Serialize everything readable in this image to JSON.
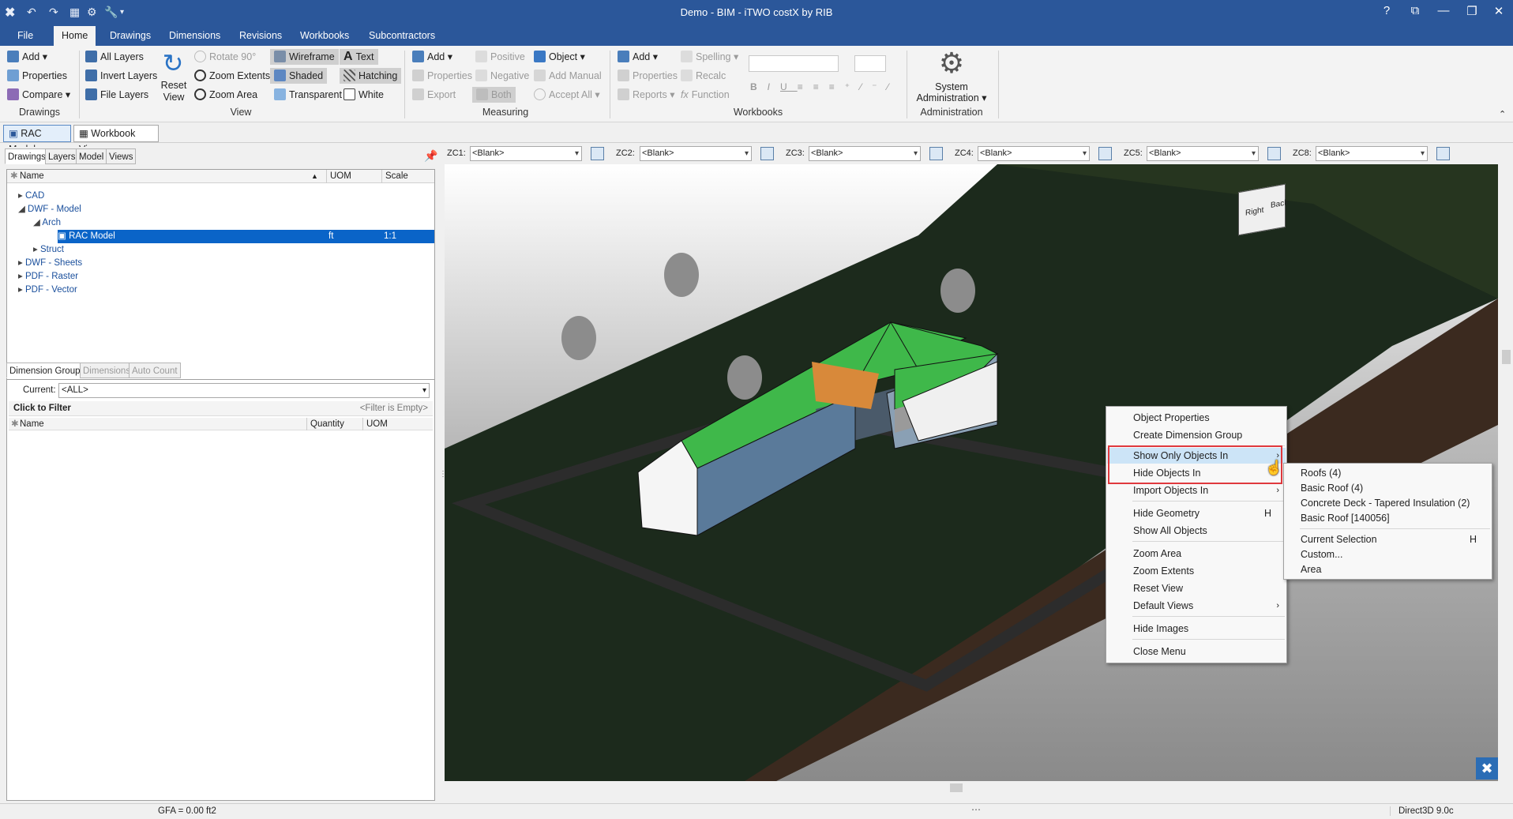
{
  "app": {
    "title": "Demo - BIM - iTWO costX by RIB",
    "window_controls": [
      "?",
      "⧉",
      "—",
      "❐",
      "✕"
    ]
  },
  "ribbon_tabs": [
    "File",
    "Home",
    "Drawings",
    "Dimensions",
    "Revisions",
    "Workbooks",
    "Subcontractors"
  ],
  "ribbon": {
    "drawings": {
      "add": "Add",
      "properties": "Properties",
      "compare": "Compare",
      "group": "Drawings"
    },
    "layers": {
      "all": "All Layers",
      "invert": "Invert Layers",
      "file": "File Layers",
      "reset": "Reset View"
    },
    "view": {
      "rotate": "Rotate 90°",
      "zoom_extents": "Zoom Extents",
      "zoom_area": "Zoom Area",
      "wireframe": "Wireframe",
      "shaded": "Shaded",
      "transparent": "Transparent",
      "text": "Text",
      "hatching": "Hatching",
      "white": "White",
      "group": "View"
    },
    "measuring": {
      "add": "Add",
      "properties": "Properties",
      "export": "Export",
      "positive": "Positive",
      "negative": "Negative",
      "both": "Both",
      "object": "Object",
      "add_manual": "Add Manual",
      "accept_all": "Accept All",
      "group": "Measuring"
    },
    "workbooks": {
      "add": "Add",
      "properties": "Properties",
      "reports": "Reports",
      "spelling": "Spelling",
      "recalc": "Recalc",
      "function": "Function",
      "group": "Workbooks"
    },
    "admin": {
      "system": "System",
      "administration": "Administration ▾",
      "group": "Administration"
    }
  },
  "doc_tabs": [
    "RAC Model",
    "Workbook View"
  ],
  "left_panel": {
    "tabs": [
      "Drawings",
      "Layers",
      "Model",
      "Views"
    ],
    "tree_headers": [
      "Name",
      "UOM",
      "Scale"
    ],
    "tree_rows": [
      {
        "label": "CAD",
        "uom": "",
        "scale": ""
      },
      {
        "label": "DWF - Model",
        "uom": "",
        "scale": ""
      },
      {
        "label": "Arch",
        "uom": "",
        "scale": ""
      },
      {
        "label": "RAC Model",
        "uom": "ft",
        "scale": "1:1"
      },
      {
        "label": "Struct",
        "uom": "",
        "scale": ""
      },
      {
        "label": "DWF - Sheets",
        "uom": "",
        "scale": ""
      },
      {
        "label": "PDF - Raster",
        "uom": "",
        "scale": ""
      },
      {
        "label": "PDF - Vector",
        "uom": "",
        "scale": ""
      }
    ],
    "dim_tabs": [
      "Dimension Groups",
      "Dimensions",
      "Auto Count"
    ],
    "current_label": "Current:",
    "current_value": "<ALL>",
    "filter_label": "Click to Filter",
    "filter_status": "<Filter is Empty>",
    "dim_headers": [
      "Name",
      "Quantity",
      "UOM"
    ]
  },
  "zc_filters": [
    {
      "label": "ZC1:",
      "value": "<Blank>"
    },
    {
      "label": "ZC2:",
      "value": "<Blank>"
    },
    {
      "label": "ZC3:",
      "value": "<Blank>"
    },
    {
      "label": "ZC4:",
      "value": "<Blank>"
    },
    {
      "label": "ZC5:",
      "value": "<Blank>"
    },
    {
      "label": "ZC8:",
      "value": "<Blank>"
    }
  ],
  "context_menu": [
    {
      "label": "Object Properties",
      "shortcut": "",
      "submenu": false
    },
    {
      "label": "Create Dimension Group",
      "shortcut": "",
      "submenu": false
    },
    {
      "label": "Show Only Objects In",
      "shortcut": "",
      "submenu": true,
      "highlighted": true
    },
    {
      "label": "Hide Objects In",
      "shortcut": "",
      "submenu": false
    },
    {
      "label": "Import Objects In",
      "shortcut": "",
      "submenu": true
    },
    {
      "label": "Hide Geometry",
      "shortcut": "H",
      "submenu": false
    },
    {
      "label": "Show All Objects",
      "shortcut": "",
      "submenu": false
    },
    {
      "label": "Zoom Area",
      "shortcut": "",
      "submenu": false
    },
    {
      "label": "Zoom Extents",
      "shortcut": "",
      "submenu": false
    },
    {
      "label": "Reset View",
      "shortcut": "",
      "submenu": false
    },
    {
      "label": "Default Views",
      "shortcut": "",
      "submenu": true
    },
    {
      "label": "Hide Images",
      "shortcut": "",
      "submenu": false
    },
    {
      "label": "Close Menu",
      "shortcut": "",
      "submenu": false
    }
  ],
  "submenu": [
    {
      "label": "Roofs (4)",
      "shortcut": ""
    },
    {
      "label": "Basic Roof (4)",
      "shortcut": ""
    },
    {
      "label": "Concrete Deck - Tapered Insulation (2)",
      "shortcut": ""
    },
    {
      "label": "Basic Roof [140056]",
      "shortcut": ""
    },
    {
      "label": "Current Selection",
      "shortcut": "H"
    },
    {
      "label": "Custom...",
      "shortcut": ""
    },
    {
      "label": "Area",
      "shortcut": ""
    }
  ],
  "viewcube": {
    "right": "Right",
    "back": "Back"
  },
  "status": {
    "gfa": "GFA = 0.00 ft2",
    "renderer": "Direct3D 9.0c"
  },
  "colors": {
    "titlebar": "#2b579a",
    "selection": "#0a64c8",
    "highlight_box": "#e0393e",
    "roof": "#3fb84a"
  }
}
